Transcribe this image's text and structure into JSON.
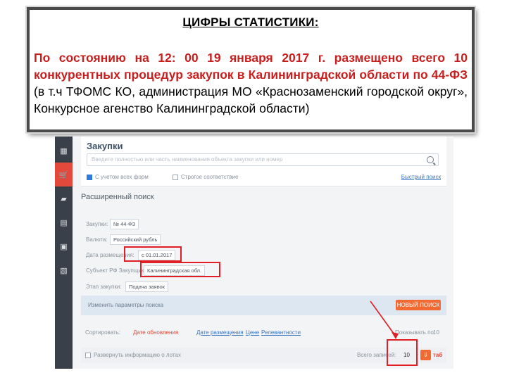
{
  "callout": {
    "title": "ЦИФРЫ СТАТИСТИКИ:",
    "lead": "По состоянию на 12: 00 19 января 2017 г. размещено всего 10 конкурентных процедур закупок в Калининградской области по",
    "law": "44-ФЗ",
    "rest": "(в т.ч ТФОМС КО, администрация МО «Краснозаменский городской округ», Конкурсное агенство Калининградской области)"
  },
  "app": {
    "section_title": "Закупки",
    "search_placeholder": "Введите полностью или часть наименования объекта закупки или номер",
    "option1": "С учетом всех форм",
    "option2": "Строгое соответствие",
    "quick_search": "Быстрый поиск",
    "advanced_title": "Расширенный поиск",
    "filters": [
      {
        "label": "Закупки:",
        "value": "№ 44-ФЗ"
      },
      {
        "label": "Валюта:",
        "value": "Российский рубль"
      },
      {
        "label": "Дата размещения:",
        "value": "с 01.01.2017"
      },
      {
        "label": "Субъект РФ Закупщика:",
        "value": "Калининградская обл."
      },
      {
        "label": "Этап закупки:",
        "value": "Подача заявок"
      }
    ],
    "edit_params": "Изменить параметры поиска",
    "new_search": "НОВЫЙ ПОИСК",
    "sort_label": "Сортировать:",
    "sort_value": "Дате обновления",
    "sort_links": [
      "Дате размещения",
      "Цене",
      "Релевантности"
    ],
    "per_page_label": "Показывать по:",
    "per_page_value": "10",
    "expand_info": "Развернуть информацию о лотах",
    "total_label": "Всего записей:",
    "total_value": "10",
    "export_label": "таб"
  },
  "colors": {
    "accent": "#e2493b",
    "highlight": "#e01e25",
    "law": "#c81e1e"
  }
}
